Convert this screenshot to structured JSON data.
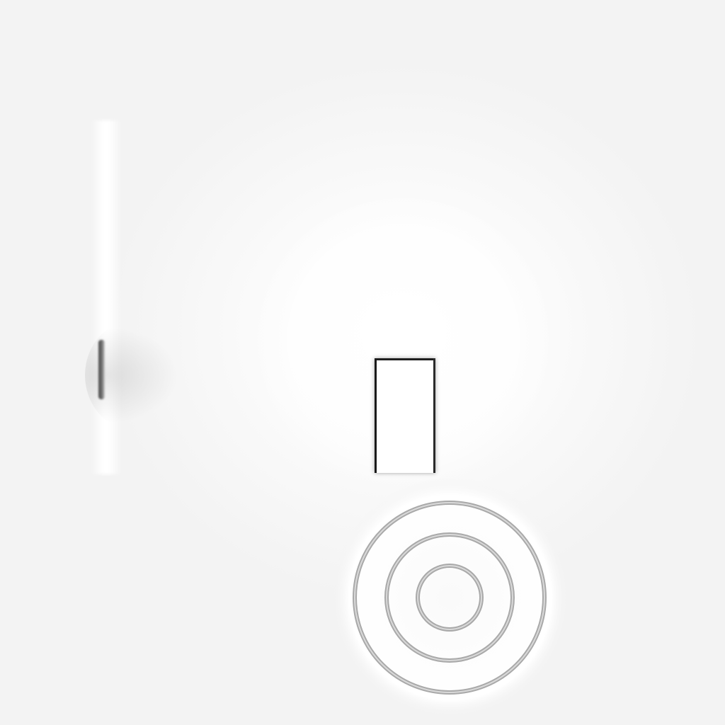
{
  "scene": {
    "background_color": "#f2f2f2",
    "highlight_color": "#ffffff",
    "ring_color": "#b0b0b0",
    "ring_count": 3,
    "objects": [
      "left-slit",
      "white-pillar",
      "concentric-ring-target"
    ]
  }
}
